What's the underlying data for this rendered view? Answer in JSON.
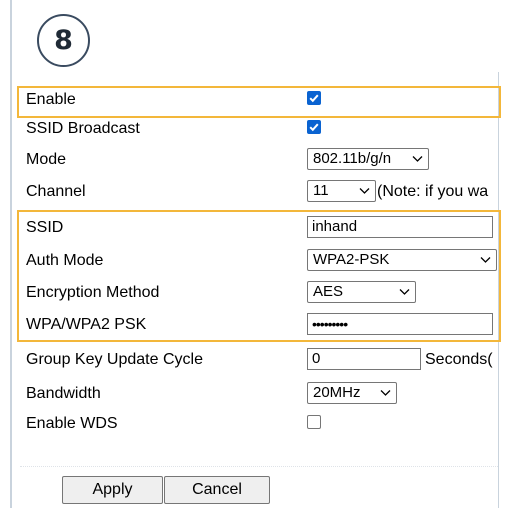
{
  "step_number": "8",
  "rows": {
    "enable": {
      "label": "Enable",
      "checked": true
    },
    "ssid_broadcast": {
      "label": "SSID Broadcast",
      "checked": true
    },
    "mode": {
      "label": "Mode",
      "value": "802.11b/g/n"
    },
    "channel": {
      "label": "Channel",
      "value": "11",
      "note": "(Note: if you wa"
    },
    "ssid": {
      "label": "SSID",
      "value": "inhand"
    },
    "auth_mode": {
      "label": "Auth Mode",
      "value": "WPA2-PSK"
    },
    "encryption": {
      "label": "Encryption Method",
      "value": "AES"
    },
    "psk": {
      "label": "WPA/WPA2 PSK",
      "value": "•••••••••"
    },
    "group_key": {
      "label": "Group Key Update Cycle",
      "value": "0",
      "unit": "Seconds("
    },
    "bandwidth": {
      "label": "Bandwidth",
      "value": "20MHz"
    },
    "wds": {
      "label": "Enable WDS",
      "checked": false
    }
  },
  "buttons": {
    "apply": "Apply",
    "cancel": "Cancel"
  },
  "colors": {
    "highlight": "#f3b73a",
    "checkbox": "#0a63d1",
    "step_ring": "#3a4b60"
  }
}
